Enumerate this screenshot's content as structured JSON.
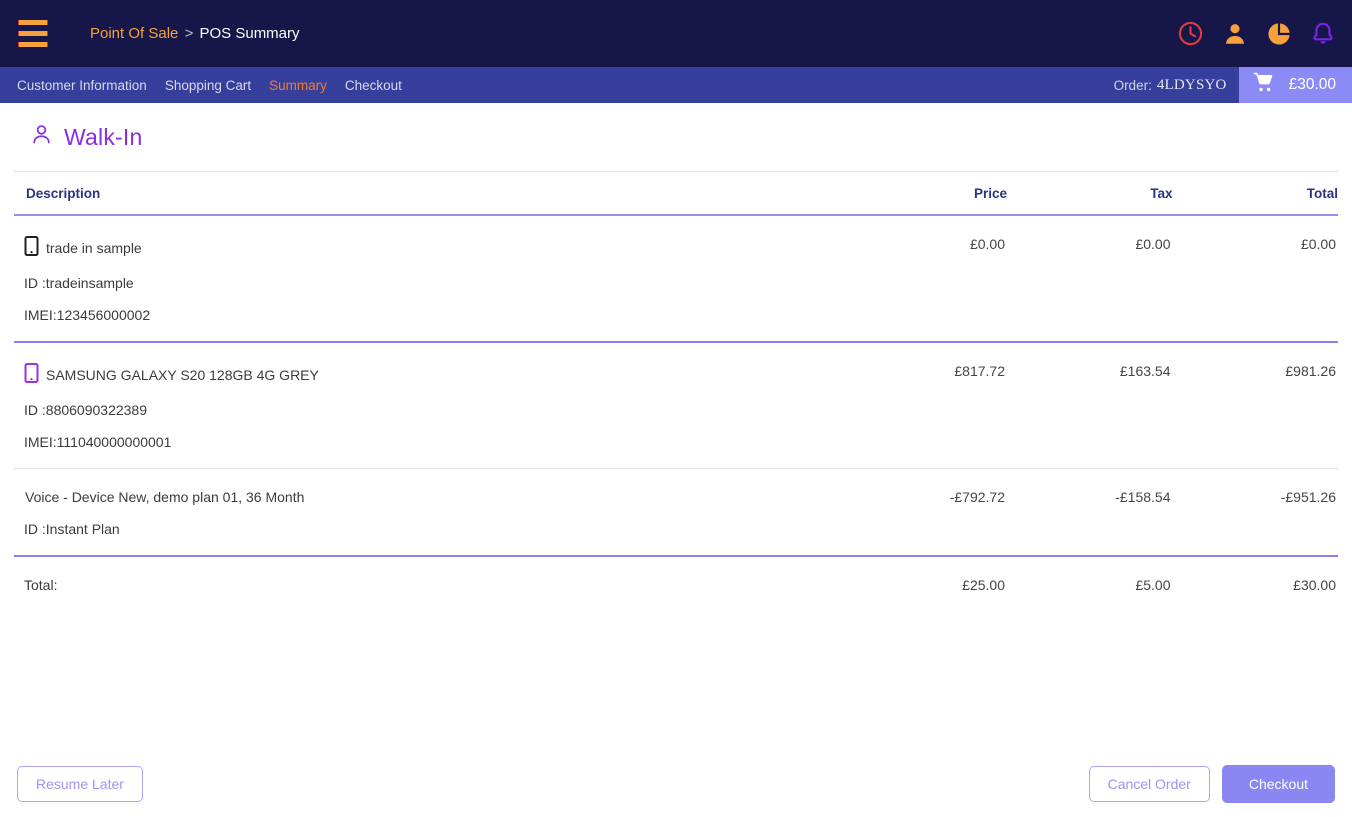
{
  "topbar": {
    "menu_label": "menu",
    "breadcrumb": {
      "parent": "Point Of Sale",
      "separator": ">",
      "current": "POS Summary"
    },
    "icons": [
      {
        "name": "clock-icon",
        "color": "#e03a3a"
      },
      {
        "name": "user-icon",
        "color": "#f7a13c"
      },
      {
        "name": "pie-chart-icon",
        "color": "#f7a13c"
      },
      {
        "name": "bell-icon",
        "color": "#7a23e8"
      }
    ],
    "bg": "#161748"
  },
  "navbar": {
    "bg": "#363f9c",
    "tabs": [
      {
        "label": "Customer Information",
        "active": false
      },
      {
        "label": "Shopping Cart",
        "active": false
      },
      {
        "label": "Summary",
        "active": true
      },
      {
        "label": "Checkout",
        "active": false
      }
    ],
    "active_color": "#f07c2e",
    "order_label": "Order:",
    "order_code": "4LDYSYO",
    "cart": {
      "icon": "shopping-cart-icon",
      "amount": "£30.00",
      "bg": "#8b8bf5"
    }
  },
  "customer": {
    "icon": "person-icon",
    "name": "Walk-In",
    "color": "#8b2be2"
  },
  "table": {
    "headers": {
      "description": "Description",
      "price": "Price",
      "tax": "Tax",
      "total": "Total"
    },
    "rows": [
      {
        "icon": "phone-icon",
        "icon_color": "#212121",
        "name": "trade in sample",
        "id_line": "ID :tradeinsample",
        "imei_line": "IMEI:123456000002",
        "price": "£0.00",
        "tax": "£0.00",
        "total": "£0.00"
      },
      {
        "icon": "phone-icon",
        "icon_color": "#9b2fe8",
        "name": "SAMSUNG GALAXY S20 128GB 4G GREY",
        "id_line": "ID :8806090322389",
        "imei_line": "IMEI:111040000000001",
        "price": "£817.72",
        "tax": "£163.54",
        "total": "£981.26"
      },
      {
        "icon": null,
        "icon_color": null,
        "name": "Voice - Device New, demo plan 01, 36 Month",
        "id_line": "ID :Instant Plan",
        "imei_line": null,
        "price": "-£792.72",
        "tax": "-£158.54",
        "total": "-£951.26"
      }
    ],
    "totals": {
      "label": "Total:",
      "price": "£25.00",
      "tax": "£5.00",
      "total": "£30.00"
    }
  },
  "footer": {
    "resume_later": "Resume Later",
    "cancel_order": "Cancel Order",
    "checkout": "Checkout"
  }
}
